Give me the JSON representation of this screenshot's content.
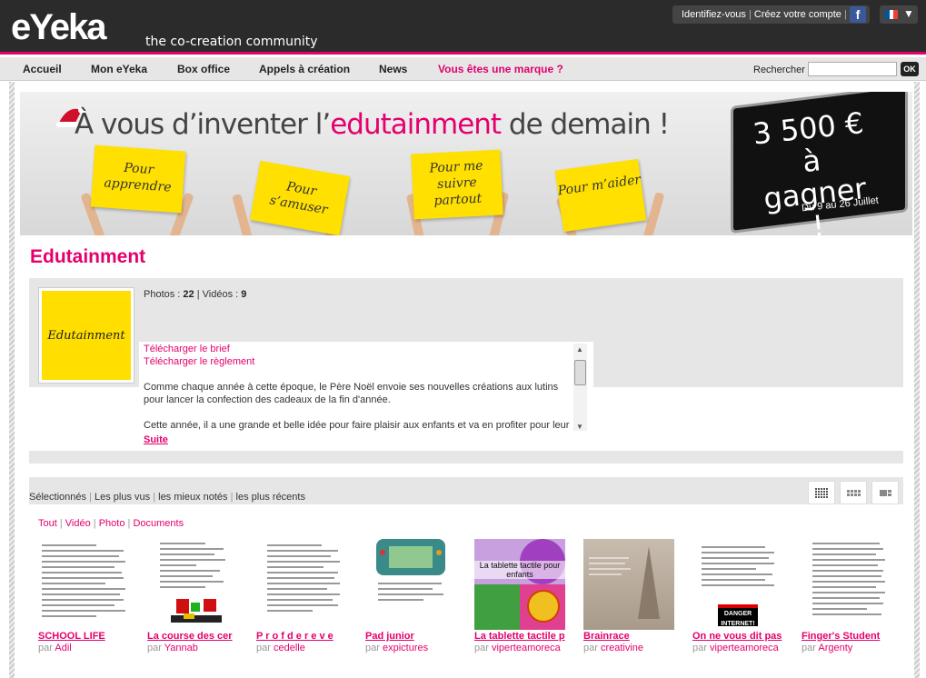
{
  "header": {
    "logo": "eYeka",
    "tagline": "the co-creation community",
    "login": "Identifiez-vous",
    "signup": "Créez votre compte",
    "login_sep": "|",
    "fb_icon": "facebook-icon",
    "flag_colors": [
      "#0055a4",
      "#ffffff",
      "#ef4135"
    ]
  },
  "nav": {
    "items": [
      "Accueil",
      "Mon eYeka",
      "Box office",
      "Appels à création",
      "News"
    ],
    "brand": "Vous êtes une marque ?",
    "search_label": "Rechercher",
    "search_value": "",
    "ok": "OK"
  },
  "banner": {
    "headline_pre": "À vous d’inventer l’",
    "headline_pink": "edutainment",
    "headline_post": " de demain !",
    "signs": [
      "Pour apprendre",
      "Pour s’amuser",
      "Pour me suivre partout",
      "Pour m’aider"
    ],
    "prize": "3 500 € à gagner !",
    "dates": "Du 9 au 26 Juillet"
  },
  "contest": {
    "title": "Edutainment",
    "thumb_text": "Edutainment",
    "photos_label": "Photos :",
    "photos": "22",
    "videos_label": "Vidéos :",
    "videos": "9",
    "stats_sep": "|",
    "download_brief": "Télécharger le brief",
    "download_rules": "Télécharger le règlement",
    "desc_p1": "Comme chaque année à cette époque, le Père Noël envoie ses nouvelles créations aux lutins pour lancer la confection des cadeaux de la fin d'année.",
    "desc_p2": "Cette année, il a une grande et belle idée pour faire plaisir aux enfants et va en profiter pour leur",
    "more": "Suite"
  },
  "sort": {
    "tabs": [
      "Sélectionnés",
      "Les plus vus",
      "les mieux notés",
      "les plus récents"
    ],
    "sep": "|"
  },
  "filters": {
    "items": [
      "Tout",
      "Vidéo",
      "Photo",
      "Documents"
    ],
    "sep": "|"
  },
  "accent_color": "#e4006d",
  "gallery": {
    "by": "par",
    "items": [
      {
        "title": "SCHOOL LIFE",
        "author": "Adil"
      },
      {
        "title": "La course des cer",
        "author": "Yannab"
      },
      {
        "title": "P r o f d e r e v e",
        "author": "cedelle"
      },
      {
        "title": "Pad junior",
        "author": "expictures"
      },
      {
        "title": "La tablette tactile p",
        "author": "viperteamoreca",
        "img_text": "La tablette tactile pour enfants"
      },
      {
        "title": "Brainrace",
        "author": "creativine"
      },
      {
        "title": "On ne vous dit pas",
        "author": "viperteamoreca",
        "img_text": "DANGER INTERNET!"
      },
      {
        "title": "Finger's Student",
        "author": "Argenty"
      }
    ]
  }
}
